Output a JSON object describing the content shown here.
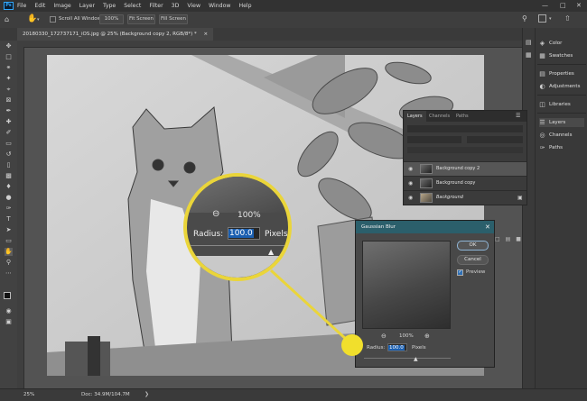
{
  "app": {
    "logo_text": "Ps"
  },
  "menu": [
    "File",
    "Edit",
    "Image",
    "Layer",
    "Type",
    "Select",
    "Filter",
    "3D",
    "View",
    "Window",
    "Help"
  ],
  "window_controls": {
    "minimize": "—",
    "maximize": "□",
    "close": "✕"
  },
  "options_bar": {
    "scroll_all_windows": "Scroll All Windows",
    "zoom_100": "100%",
    "fit_screen": "Fit Screen",
    "fill_screen": "Fill Screen"
  },
  "document_tab": {
    "title": "20180330_172737171_iOS.jpg @ 25% (Background copy 2, RGB/8*) *",
    "close": "×"
  },
  "dock": {
    "group1": [
      "Color",
      "Swatches"
    ],
    "group2": [
      "Properties",
      "Adjustments"
    ],
    "group3": [
      "Libraries"
    ],
    "group4": [
      "Layers",
      "Channels",
      "Paths"
    ]
  },
  "layers_panel": {
    "tabs": [
      "Layers",
      "Channels",
      "Paths"
    ],
    "layers": [
      {
        "name": "Background copy 2",
        "selected": true
      },
      {
        "name": "Background copy",
        "selected": false
      },
      {
        "name": "Background",
        "selected": false,
        "locked": true
      }
    ]
  },
  "gaussian_blur": {
    "title": "Gaussian Blur",
    "ok": "OK",
    "cancel": "Cancel",
    "preview_label": "Preview",
    "zoom": "100%",
    "radius_label": "Radius:",
    "radius_value": "100.0",
    "units": "Pixels"
  },
  "magnifier": {
    "zoom": "100%",
    "radius_label": "Radius:",
    "radius_value": "100.0",
    "units": "Pixels"
  },
  "status_bar": {
    "zoom": "25%",
    "doc_info": "Doc: 34.9M/104.7M"
  },
  "colors": {
    "callout_yellow": "#ead53a",
    "dialog_title": "#2b5f6b",
    "selection_blue": "#1b5fb0"
  }
}
